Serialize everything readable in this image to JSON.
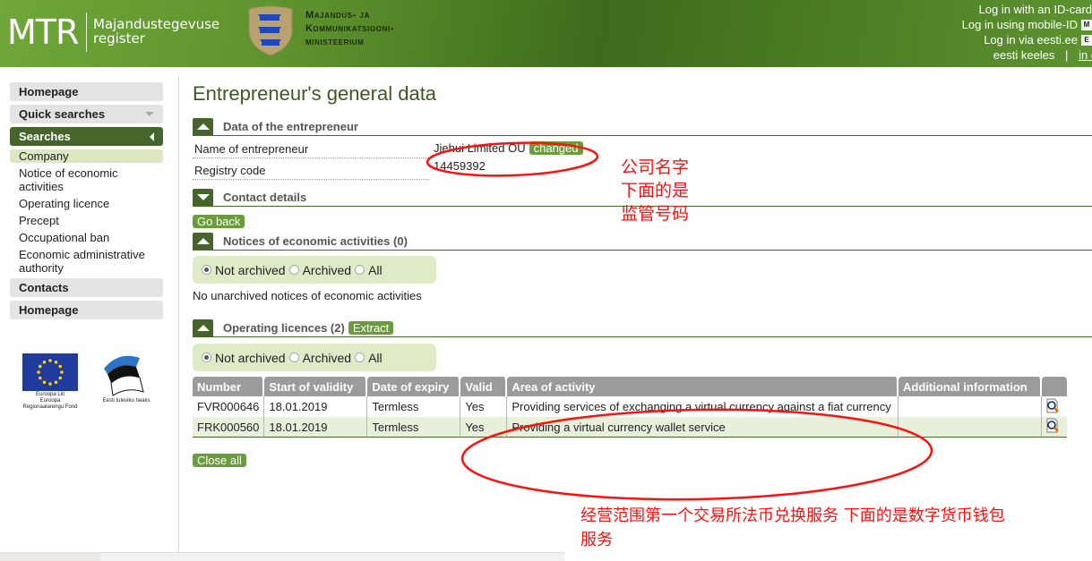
{
  "header": {
    "logo": "MTR",
    "subtitle_line1": "Majandustegevuse",
    "subtitle_line2": "register",
    "ministry_line1": "Majandus- ja",
    "ministry_line2": "Kommunikatsiooni-",
    "ministry_line3": "ministeerium",
    "login_id_card": "Log in with an ID-card",
    "login_mobile": "Log in using mobile-ID",
    "login_eesti": "Log in via eesti.ee",
    "mobile_badge": "M",
    "eesti_badge": "E",
    "lang_et": "eesti keeles",
    "lang_sep": "|",
    "lang_en": "in english"
  },
  "sidebar": {
    "homepage": "Homepage",
    "quick_searches": "Quick searches",
    "searches": "Searches",
    "sub_items": [
      "Company",
      "Notice of economic activities",
      "Operating licence",
      "Precept",
      "Occupational ban",
      "Economic administrative authority"
    ],
    "contacts": "Contacts",
    "homepage2": "Homepage",
    "eu_text_1": "Euroopa Liit",
    "eu_text_2": "Euroopa",
    "eu_text_3": "Regionaalarengu Fond",
    "ee_text": "Eesti tuleviku heaks"
  },
  "main": {
    "title": "Entrepreneur's general data",
    "sections": {
      "entrepreneur": {
        "title": "Data of the entrepreneur",
        "name_label": "Name of entrepreneur",
        "name_value": "Jiehui Limited OÜ",
        "name_badge": "changed",
        "code_label": "Registry code",
        "code_value": "14459392"
      },
      "contact": {
        "title": "Contact details"
      },
      "go_back": "Go back",
      "notices": {
        "title": "Notices of economic activities (0)",
        "filter": {
          "not_archived": "Not archived",
          "archived": "Archived",
          "all": "All",
          "selected": "Not archived"
        },
        "empty": "No unarchived notices of economic activities"
      },
      "licences": {
        "title": "Operating licences (2)",
        "extract": "Extract",
        "filter": {
          "not_archived": "Not archived",
          "archived": "Archived",
          "all": "All",
          "selected": "Not archived"
        },
        "columns": [
          "Number",
          "Start of validity",
          "Date of expiry",
          "Valid",
          "Area of activity",
          "Additional information",
          ""
        ],
        "rows": [
          {
            "number": "FVR000646",
            "start": "18.01.2019",
            "expiry": "Termless",
            "valid": "Yes",
            "area": "Providing services of exchanging a virtual currency against a fiat currency",
            "info": ""
          },
          {
            "number": "FRK000560",
            "start": "18.01.2019",
            "expiry": "Termless",
            "valid": "Yes",
            "area": "Providing a virtual currency wallet service",
            "info": ""
          }
        ]
      },
      "close_all": "Close all"
    }
  },
  "annotations": {
    "note1_line1": "公司名字",
    "note1_line2": "下面的是",
    "note1_line3": "监管号码",
    "note2_line1": "经营范围第一个交易所法币兑换服务 下面的是数字货币钱包",
    "note2_line2": "服务",
    "color": "#ff1010"
  }
}
